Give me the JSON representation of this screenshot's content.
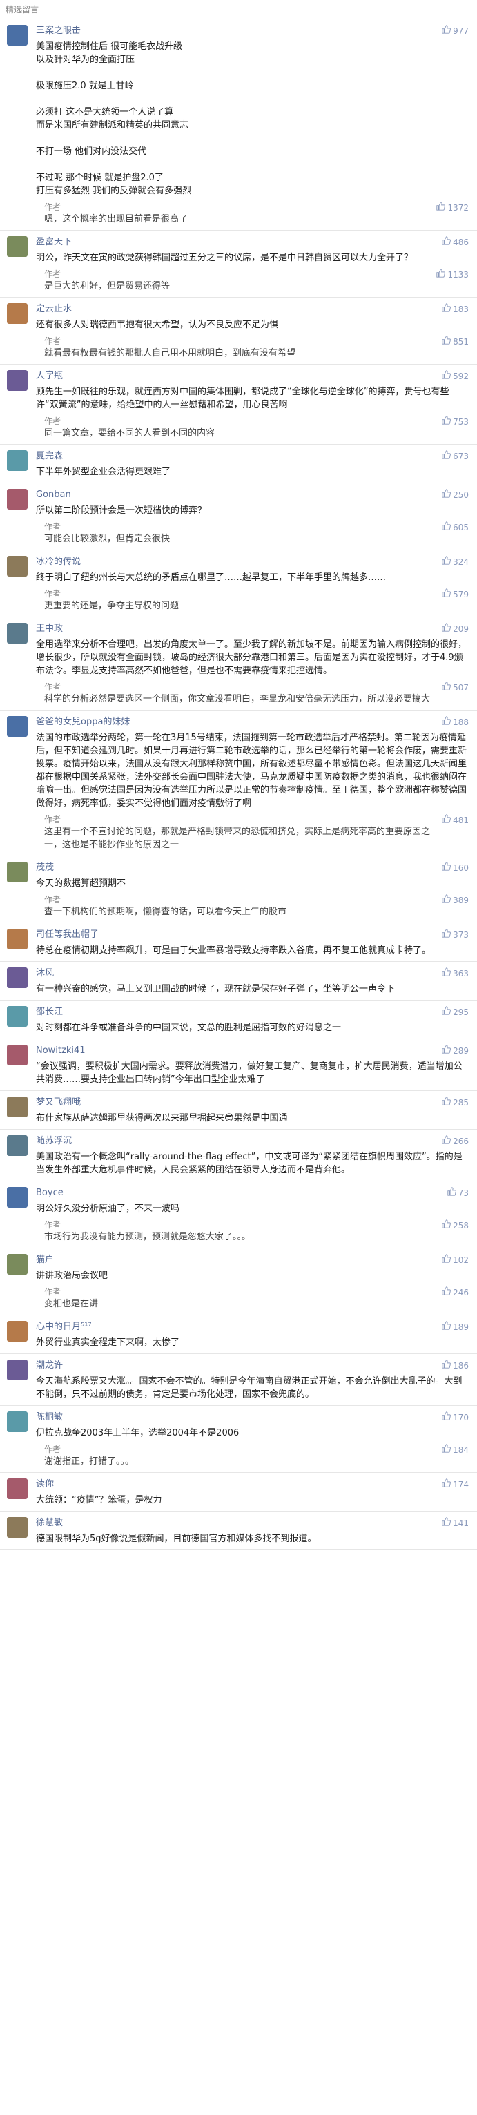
{
  "section_title": "精选留言",
  "colors": {
    "nickname": "#576b95",
    "like": "#8c9bbd",
    "divider": "#e6e6e6",
    "author_reply_bar": "#f0f0f0"
  },
  "comments": [
    {
      "nickname": "三案之眼击",
      "likes": "977",
      "content": "美国疫情控制住后 很可能毛衣战升级\n以及针对华为的全面打压\n\n极限施压2.0 就是上甘岭\n\n必须打 这不是大统领一个人说了算\n而是米国所有建制派和精英的共同意志\n\n不打一场 他们对内没法交代\n\n不过呢 那个时候 就是护盘2.0了\n打压有多猛烈 我们的反弹就会有多强烈",
      "reply_label": "作者",
      "reply_likes": "1372",
      "reply": "嗯，这个概率的出现目前看是很高了"
    },
    {
      "nickname": "盈富天下",
      "likes": "486",
      "content": "明公，昨天文在寅的政党获得韩国超过五分之三的议席，是不是中日韩自贸区可以大力全开了？",
      "reply_label": "作者",
      "reply_likes": "1133",
      "reply": "是巨大的利好，但是贸易还得等"
    },
    {
      "nickname": "定云止水",
      "likes": "183",
      "content": "还有很多人对瑞德西韦抱有很大希望，认为不良反应不足为惧",
      "reply_label": "作者",
      "reply_likes": "851",
      "reply": "就看最有权最有钱的那批人自己用不用就明白，到底有没有希望"
    },
    {
      "nickname": "人字瓶",
      "likes": "592",
      "content": "顾先生一如既往的乐观，就连西方对中国的集体围剿，都说成了“全球化与逆全球化”的搏弈，贵号也有些许“双簧流”的意味，给绝望中的人一丝慰藉和希望，用心良苦啊",
      "reply_label": "作者",
      "reply_likes": "753",
      "reply": "同一篇文章，要给不同的人看到不同的内容"
    },
    {
      "nickname": "夏完森",
      "likes": "673",
      "content": "下半年外贸型企业会活得更艰难了",
      "reply_label": "",
      "reply_likes": "",
      "reply": ""
    },
    {
      "nickname": "Gonban",
      "likes": "250",
      "content": "所以第二阶段预计会是一次短档快的博弈？",
      "reply_label": "作者",
      "reply_likes": "605",
      "reply": "可能会比较激烈，但肯定会很快"
    },
    {
      "nickname": "冰冷的传说",
      "likes": "324",
      "content": "终于明白了纽约州长与大总统的矛盾点在哪里了……越早复工，下半年手里的牌越多……",
      "reply_label": "作者",
      "reply_likes": "579",
      "reply": "更重要的还是，争夺主导权的问题"
    },
    {
      "nickname": "王中政",
      "likes": "209",
      "content": "全用选举来分析不合理吧，出发的角度太单一了。至少我了解的新加坡不是。前期因为输入病例控制的很好，增长很少，所以就没有全面封锁，坡岛的经济很大部分靠港口和第三。后面是因为实在没控制好，才于4.9颁布法令。李显龙支持率高然不如他爸爸，但是也不需要靠疫情来把控选情。",
      "reply_label": "作者",
      "reply_likes": "507",
      "reply": "科学的分析必然是要选区一个侧面，你文章没看明白，李显龙和安倍毫无选压力，所以没必要搞大"
    },
    {
      "nickname": "爸爸的女兒oppa的妹妹",
      "likes": "188",
      "content": "法国的市政选举分两轮，第一轮在3月15号结束，法国拖到第一轮市政选举后才严格禁封。第二轮因为疫情延后，但不知道会延到几时。如果十月再进行第二轮市政选举的话，那么已经举行的第一轮将会作废，需要重新投票。疫情开始以来，法国从没有跟大利那样称赞中国，所有叙述都尽量不带感情色彩。但法国这几天新闻里都在根据中国关系紧张，法外交部长会面中国驻法大使，马克龙质疑中国防疫数据之类的消息，我也很纳闷在暗喻一出。但感觉法国是因为没有选举压力所以是以正常的节奏控制疫情。至于德国，整个欧洲都在称赞德国做得好，病死率低，委实不觉得他们面对疫情敷衍了啊",
      "reply_label": "作者",
      "reply_likes": "481",
      "reply": "这里有一个不宣讨论的问题，那就是严格封锁带来的恐慌和挤兑，实际上是病死率高的重要原因之一，这也是不能抄作业的原因之一"
    },
    {
      "nickname": "茂茂",
      "likes": "160",
      "content": "今天的数据算超预期不",
      "reply_label": "作者",
      "reply_likes": "389",
      "reply": "查一下机构们的预期啊，懒得查的话，可以看今天上午的股市"
    },
    {
      "nickname": "司任等我出帽子",
      "likes": "373",
      "content": "特总在疫情初期支持率飙升，可是由于失业率暴增导致支持率跌入谷底，再不复工他就真成卡特了。",
      "reply_label": "",
      "reply_likes": "",
      "reply": ""
    },
    {
      "nickname": "沐风",
      "likes": "363",
      "content": "有一种兴奋的感觉，马上又到卫国战的时候了，现在就是保存好子弹了，坐等明公一声令下",
      "reply_label": "",
      "reply_likes": "",
      "reply": ""
    },
    {
      "nickname": "邵长江",
      "likes": "295",
      "content": "对时刻都在斗争或准备斗争的中国来说，文总的胜利是屈指可数的好消息之一",
      "reply_label": "",
      "reply_likes": "",
      "reply": ""
    },
    {
      "nickname": "Nowitzki41",
      "likes": "289",
      "content": "“会议强调，要积极扩大国内需求。要释放消费潜力，做好复工复产、复商复市，扩大居民消费，适当增加公共消费……要支持企业出口转内销”今年出口型企业太难了",
      "reply_label": "",
      "reply_likes": "",
      "reply": ""
    },
    {
      "nickname": "梦又飞翔哦",
      "likes": "285",
      "content": "布什家族从萨达姆那里获得两次以来那里掘起来😎果然是中国通",
      "reply_label": "",
      "reply_likes": "",
      "reply": ""
    },
    {
      "nickname": "随苏浮沉",
      "likes": "266",
      "content": "美国政治有一个概念叫“rally-around-the-flag effect”，中文或可译为“紧紧团结在旗帜周围效应”。指的是当发生外部重大危机事件时候，人民会紧紧的团结在领导人身边而不是背弃他。",
      "reply_label": "",
      "reply_likes": "",
      "reply": ""
    },
    {
      "nickname": "Boyce",
      "likes": "73",
      "content": "明公好久没分析原油了，不来一波吗",
      "reply_label": "作者",
      "reply_likes": "258",
      "reply": "市场行为我没有能力预测，预测就是忽悠大家了。。。"
    },
    {
      "nickname": "猫户",
      "likes": "102",
      "content": "讲讲政治局会议吧",
      "reply_label": "作者",
      "reply_likes": "246",
      "reply": "变相也是在讲"
    },
    {
      "nickname": "心中的日月⁵¹⁷",
      "likes": "189",
      "content": "外贸行业真实全程走下来啊，太惨了",
      "reply_label": "",
      "reply_likes": "",
      "reply": ""
    },
    {
      "nickname": "潮龙许",
      "likes": "186",
      "content": "今天海航系股票又大涨。。国家不会不管的。特别是今年海南自贸港正式开始，不会允许倒出大乱子的。大到不能倒，只不过前期的债务，肯定是要市场化处理，国家不会兜底的。",
      "reply_label": "",
      "reply_likes": "",
      "reply": ""
    },
    {
      "nickname": "陈桐敏",
      "likes": "170",
      "content": "伊拉克战争2003年上半年，选举2004年不是2006",
      "reply_label": "作者",
      "reply_likes": "184",
      "reply": "谢谢指正，打错了。。。"
    },
    {
      "nickname": "读你",
      "likes": "174",
      "content": "大统领：“疫情”？笨蛋，是权力",
      "reply_label": "",
      "reply_likes": "",
      "reply": ""
    },
    {
      "nickname": "徐慧敏",
      "likes": "141",
      "content": "德国限制华为5g好像说是假新闻，目前德国官方和媒体多找不到报道。",
      "reply_label": "",
      "reply_likes": "",
      "reply": ""
    }
  ]
}
